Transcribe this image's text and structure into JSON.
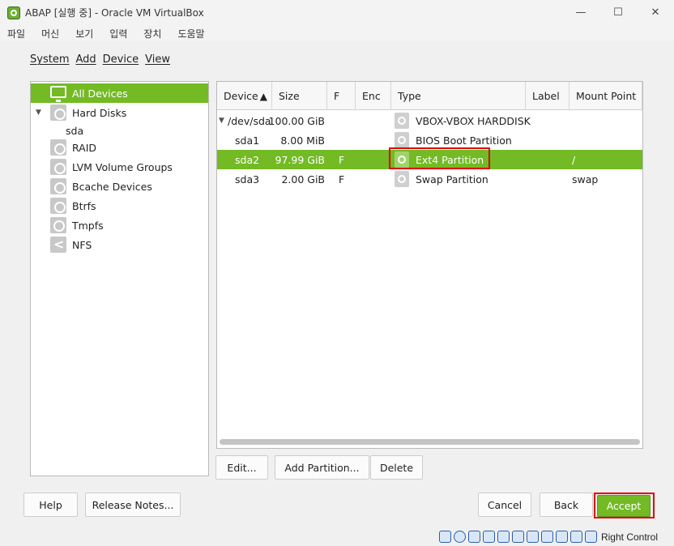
{
  "window": {
    "title": "ABAP [실행 중] - Oracle VM VirtualBox",
    "controls": [
      "—",
      "☐",
      "✕"
    ]
  },
  "host_menu": [
    "파일",
    "머신",
    "보기",
    "입력",
    "장치",
    "도움말"
  ],
  "installer_menu": [
    "System",
    "Add",
    "Device",
    "View"
  ],
  "sidebar": {
    "items": [
      {
        "label": "All Devices",
        "icon": "monitor-icon",
        "selected": true
      },
      {
        "label": "Hard Disks",
        "icon": "hard-disk-icon",
        "expanded": true
      },
      {
        "label": "sda",
        "icon": "",
        "child": true
      },
      {
        "label": "RAID",
        "icon": "raid-icon"
      },
      {
        "label": "LVM Volume Groups",
        "icon": "lvm-icon"
      },
      {
        "label": "Bcache Devices",
        "icon": "bcache-icon"
      },
      {
        "label": "Btrfs",
        "icon": "btrfs-icon"
      },
      {
        "label": "Tmpfs",
        "icon": "clock-icon"
      },
      {
        "label": "NFS",
        "icon": "share-icon"
      }
    ]
  },
  "table": {
    "columns": [
      "Device",
      "Size",
      "F",
      "Enc",
      "Type",
      "Label",
      "Mount Point"
    ],
    "sort_column": "Device",
    "rows": [
      {
        "device": "/dev/sda",
        "size": "100.00 GiB",
        "f": "",
        "enc": "",
        "type": "VBOX-VBOX HARDDISK",
        "label": "",
        "mount": "",
        "expandable": true
      },
      {
        "device": "sda1",
        "size": "8.00 MiB",
        "f": "",
        "enc": "",
        "type": "BIOS Boot Partition",
        "label": "",
        "mount": ""
      },
      {
        "device": "sda2",
        "size": "97.99 GiB",
        "f": "F",
        "enc": "",
        "type": "Ext4 Partition",
        "label": "",
        "mount": "/",
        "selected": true
      },
      {
        "device": "sda3",
        "size": "2.00 GiB",
        "f": "F",
        "enc": "",
        "type": "Swap Partition",
        "label": "",
        "mount": "swap"
      }
    ]
  },
  "actions": {
    "edit": "Edit...",
    "add_partition": "Add Partition...",
    "delete": "Delete"
  },
  "footer": {
    "help": "Help",
    "release_notes": "Release Notes...",
    "cancel": "Cancel",
    "back": "Back",
    "accept": "Accept"
  },
  "statusbar": {
    "host_key_label": "Right Control"
  },
  "colors": {
    "accent": "#73ba25",
    "highlight_box": "#e00000"
  }
}
